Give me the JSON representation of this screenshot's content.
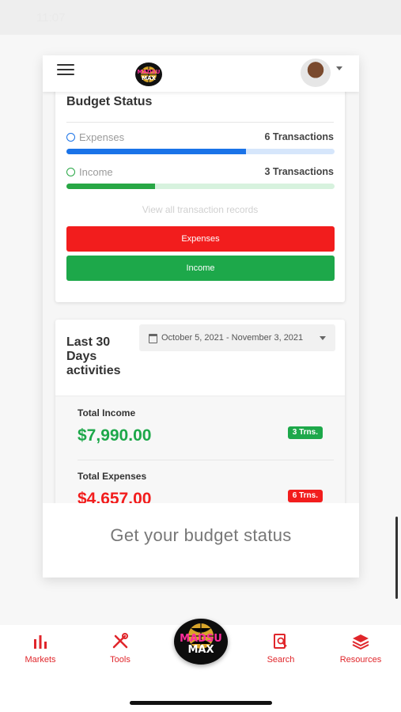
{
  "status_bar": {
    "time": "11:07"
  },
  "header": {
    "logo_top": "MADSU",
    "logo_bottom": "MAX"
  },
  "budget": {
    "title": "Budget Status",
    "expenses": {
      "label": "Expenses",
      "count": "6 Transactions",
      "fill": 0.67,
      "color": "#1a73e8",
      "track": "#d6e6fb"
    },
    "income": {
      "label": "Income",
      "count": "3 Transactions",
      "fill": 0.33,
      "color": "#28a745",
      "track": "#d7f2de"
    },
    "view_all": "View all transaction records",
    "expenses_button": "Expenses",
    "income_button": "Income"
  },
  "activities": {
    "title": "Last 30 Days activities",
    "date_range": "October 5, 2021 - November 3, 2021",
    "total_income_label": "Total Income",
    "total_income_value": "$7,990.00",
    "total_income_badge": "3 Trns.",
    "total_expenses_label": "Total Expenses",
    "total_expenses_value": "$4,657.00",
    "total_expenses_badge": "6 Trns."
  },
  "tagline": "Get your budget status",
  "nav": {
    "markets": "Markets",
    "tools": "Tools",
    "center_logo_top": "MADSU",
    "center_logo_bottom": "MAX",
    "search": "Search",
    "resources": "Resources"
  },
  "colors": {
    "red": "#f21d1d",
    "green": "#1da84a",
    "accent": "#e0262b"
  }
}
